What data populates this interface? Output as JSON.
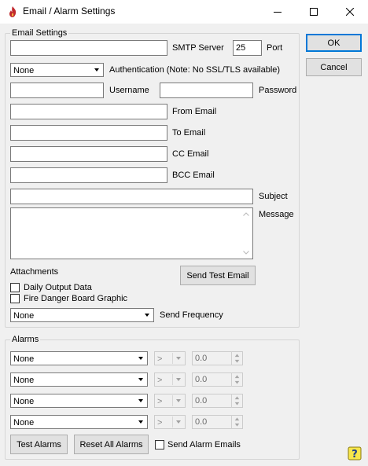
{
  "window": {
    "title": "Email / Alarm Settings",
    "icons": {
      "app": "flame-icon",
      "minimize": "minimize-icon",
      "maximize": "maximize-icon",
      "close": "close-icon"
    }
  },
  "email": {
    "group_label": "Email Settings",
    "smtp_server": {
      "label": "SMTP Server",
      "value": ""
    },
    "port": {
      "label": "Port",
      "value": "25"
    },
    "authentication": {
      "selected": "None",
      "label": "Authentication (Note: No SSL/TLS available)"
    },
    "username": {
      "label": "Username",
      "value": ""
    },
    "password": {
      "label": "Password",
      "value": ""
    },
    "from_email": {
      "label": "From Email",
      "value": ""
    },
    "to_email": {
      "label": "To Email",
      "value": ""
    },
    "cc_email": {
      "label": "CC Email",
      "value": ""
    },
    "bcc_email": {
      "label": "BCC Email",
      "value": ""
    },
    "subject": {
      "label": "Subject",
      "value": ""
    },
    "message": {
      "label": "Message",
      "value": ""
    },
    "attachments_label": "Attachments",
    "daily_output": {
      "label": "Daily Output Data",
      "checked": false
    },
    "fire_danger": {
      "label": "Fire Danger Board Graphic",
      "checked": false
    },
    "send_test_label": "Send Test Email",
    "send_frequency": {
      "selected": "None",
      "label": "Send Frequency"
    }
  },
  "alarms": {
    "group_label": "Alarms",
    "rows": [
      {
        "source": "None",
        "operator": ">",
        "value": "0.0"
      },
      {
        "source": "None",
        "operator": ">",
        "value": "0.0"
      },
      {
        "source": "None",
        "operator": ">",
        "value": "0.0"
      },
      {
        "source": "None",
        "operator": ">",
        "value": "0.0"
      }
    ],
    "test_label": "Test Alarms",
    "reset_label": "Reset All Alarms",
    "send_emails": {
      "label": "Send Alarm Emails",
      "checked": false
    }
  },
  "buttons": {
    "ok": "OK",
    "cancel": "Cancel"
  },
  "help_icon": "help-icon"
}
